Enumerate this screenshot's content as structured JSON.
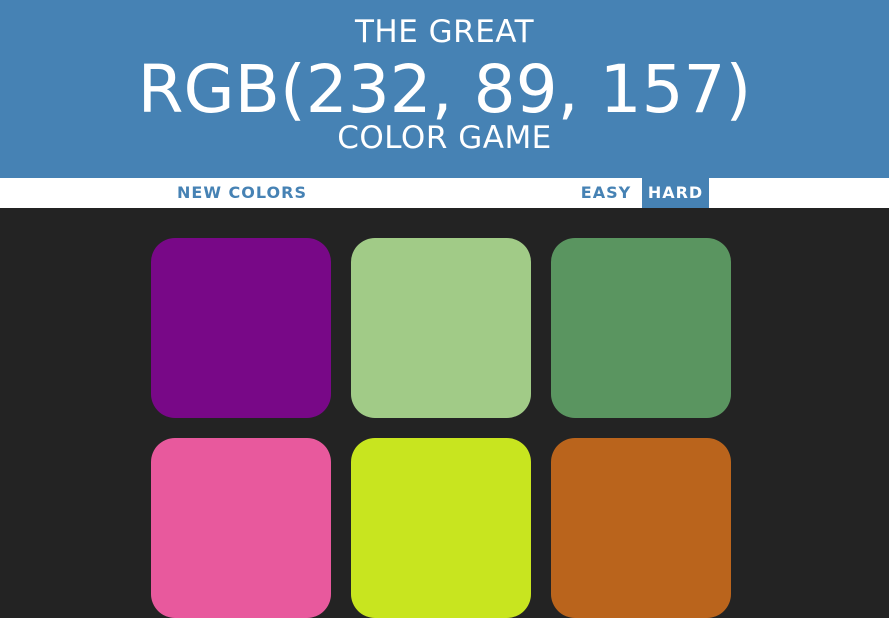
{
  "header": {
    "line1": "THE GREAT",
    "rgb": "RGB(232, 89, 157)",
    "line3": "COLOR GAME"
  },
  "stripe": {
    "new_colors": "NEW COLORS",
    "message": "",
    "easy": "EASY",
    "hard": "HARD",
    "selected_mode": "HARD"
  },
  "colors": {
    "header_bg": "#4682b4",
    "board_bg": "#232323",
    "stripe_bg": "#ffffff",
    "accent": "#4682b4"
  },
  "squares": [
    {
      "color": "#780887"
    },
    {
      "color": "#a1cb87"
    },
    {
      "color": "#5a9560"
    },
    {
      "color": "#e8599d"
    },
    {
      "color": "#c8e51f"
    },
    {
      "color": "#ba641c"
    }
  ]
}
